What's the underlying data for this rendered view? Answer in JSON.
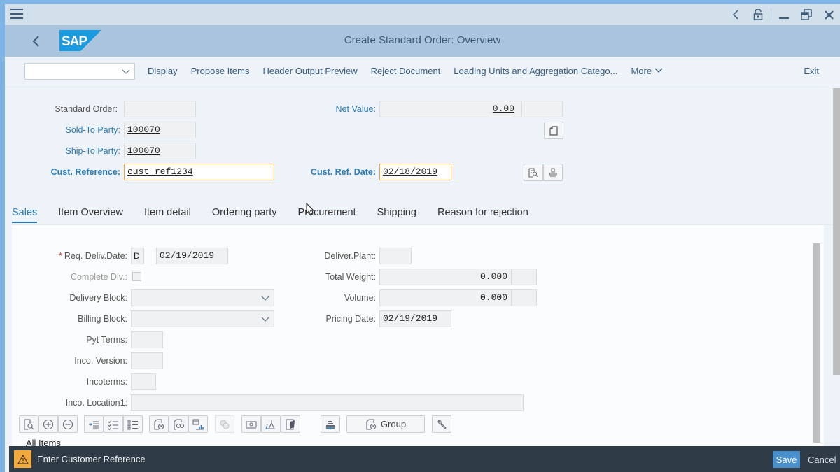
{
  "window": {
    "controls": [
      "back-icon",
      "unlock-icon",
      "minimize-icon",
      "restore-icon",
      "close-icon"
    ]
  },
  "shell": {
    "title": "Create Standard Order: Overview",
    "logo": "SAP"
  },
  "toolbar": {
    "select_value": "",
    "items": [
      "Display",
      "Propose Items",
      "Header Output Preview",
      "Reject Document",
      "Loading Units and Aggregation Catego...",
      "More"
    ],
    "exit_label": "Exit"
  },
  "header": {
    "standard_order": {
      "label": "Standard Order:",
      "value": ""
    },
    "sold_to_party": {
      "label": "Sold-To Party:",
      "value": "100070"
    },
    "ship_to_party": {
      "label": "Ship-To Party:",
      "value": "100070"
    },
    "cust_reference": {
      "label": "Cust. Reference:",
      "value": "cust_ref1234"
    },
    "net_value": {
      "label": "Net Value:",
      "value": "0.00",
      "currency": ""
    },
    "cust_ref_date": {
      "label": "Cust. Ref. Date:",
      "value": "02/18/2019"
    }
  },
  "tabs": [
    {
      "label": "Sales",
      "active": true
    },
    {
      "label": "Item Overview",
      "active": false
    },
    {
      "label": "Item detail",
      "active": false
    },
    {
      "label": "Ordering party",
      "active": false
    },
    {
      "label": "Procurement",
      "active": false
    },
    {
      "label": "Shipping",
      "active": false
    },
    {
      "label": "Reason for rejection",
      "active": false
    }
  ],
  "sales": {
    "req_deliv_date": {
      "label": "Req. Deliv.Date:",
      "period": "D",
      "value": "02/19/2019",
      "required": true
    },
    "complete_dlv": {
      "label": "Complete Dlv.:",
      "checked": false
    },
    "delivery_block": {
      "label": "Delivery Block:",
      "value": ""
    },
    "billing_block": {
      "label": "Billing Block:",
      "value": ""
    },
    "pyt_terms": {
      "label": "Pyt Terms:",
      "value": ""
    },
    "inco_version": {
      "label": "Inco. Version:",
      "value": ""
    },
    "incoterms": {
      "label": "Incoterms:",
      "value": ""
    },
    "inco_location1": {
      "label": "Inco. Location1:",
      "value": ""
    },
    "deliver_plant": {
      "label": "Deliver.Plant:",
      "value": ""
    },
    "total_weight": {
      "label": "Total Weight:",
      "value": "0.000",
      "unit": ""
    },
    "volume": {
      "label": "Volume:",
      "value": "0.000",
      "unit": ""
    },
    "pricing_date": {
      "label": "Pricing Date:",
      "value": "02/19/2019"
    }
  },
  "item_toolbar": {
    "group_label": "Group",
    "section_label": "All Items"
  },
  "statusbar": {
    "message": "Enter Customer Reference",
    "type": "warning",
    "save_label": "Save",
    "cancel_label": "Cancel"
  }
}
